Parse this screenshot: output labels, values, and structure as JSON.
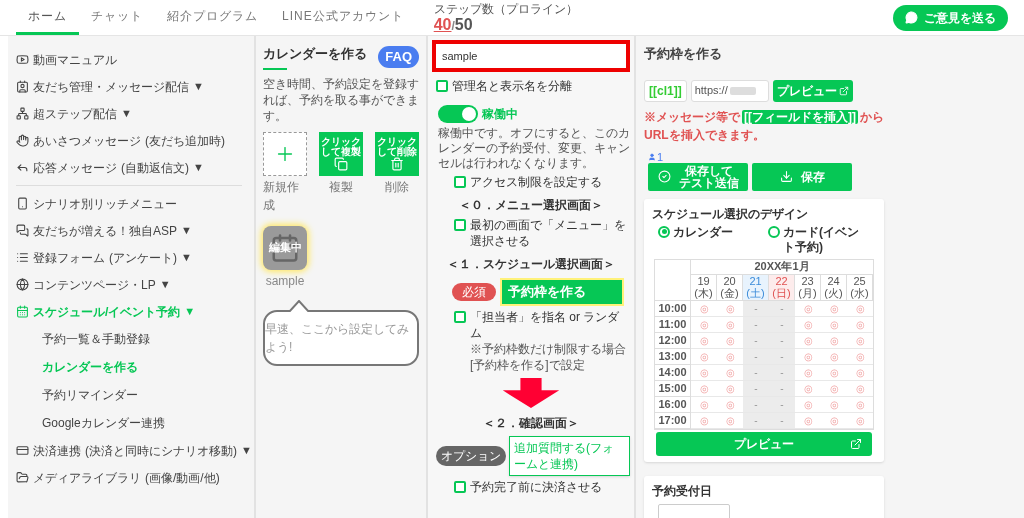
{
  "tabs": [
    {
      "label": "ホーム",
      "selected": true
    },
    {
      "label": "チャット",
      "selected": false
    },
    {
      "label": "紹介プログラム",
      "selected": false
    },
    {
      "label": "LINE公式アカウント",
      "selected": false
    }
  ],
  "step_counter": {
    "label": "ステップ数（プロライン）",
    "current": "40",
    "separator": "/",
    "total": "50"
  },
  "feedback_button": {
    "label": "ご意見を送る"
  },
  "sidebar": {
    "items": [
      {
        "kind": "item",
        "label": "動画マニュアル",
        "selected": false
      },
      {
        "kind": "item",
        "label": "友だち管理・メッセージ配信",
        "arrow": "▼",
        "selected": false
      },
      {
        "kind": "item",
        "label": "超ステップ配信",
        "arrow": "▼",
        "selected": false
      },
      {
        "kind": "item",
        "label": "あいさつメッセージ",
        "note": "(友だち追加時)",
        "selected": false
      },
      {
        "kind": "item",
        "label": "応答メッセージ",
        "note": "(自動返信文)",
        "arrow": "▼",
        "selected": false
      },
      {
        "kind": "divider"
      },
      {
        "kind": "item",
        "label": "シナリオ別リッチメニュー",
        "selected": false
      },
      {
        "kind": "item",
        "label": "友だちが増える！独自ASP",
        "arrow": "▼",
        "selected": false
      },
      {
        "kind": "item",
        "label": "登録フォーム",
        "note": "(アンケート)",
        "arrow": "▼",
        "selected": false
      },
      {
        "kind": "item",
        "label": "コンテンツページ・LP",
        "arrow": "▼",
        "selected": false
      },
      {
        "kind": "item",
        "label": "スケジュール/イベント予約",
        "arrow": "▼",
        "selected": true
      },
      {
        "kind": "sub",
        "label": "予約一覧＆手動登録",
        "selected": false
      },
      {
        "kind": "sub",
        "label": "カレンダーを作る",
        "selected": true
      },
      {
        "kind": "sub",
        "label": "予約リマインダー",
        "selected": false
      },
      {
        "kind": "sub",
        "label": "Googleカレンダー連携",
        "selected": false
      },
      {
        "kind": "item",
        "label": "決済連携",
        "note": "(決済と同時にシナリオ移動)",
        "arrow": "▼",
        "selected": false
      },
      {
        "kind": "item",
        "label": "メディアライブラリ",
        "note": "(画像/動画/他)",
        "selected": false
      }
    ]
  },
  "calendar_panel": {
    "title": "カレンダーを作る",
    "faq": "FAQ",
    "description": "空き時間、予約設定を登録すれば、予約を取る事ができます。",
    "tiles": [
      {
        "kind": "new",
        "label": "新規作成"
      },
      {
        "kind": "copy",
        "caption_lines": [
          "クリック",
          "して複製"
        ],
        "label": "複製"
      },
      {
        "kind": "delete",
        "caption_lines": [
          "クリック",
          "して削除"
        ],
        "label": "削除"
      }
    ],
    "calendars": [
      {
        "badge": "編集中",
        "name": "sample",
        "selected": true
      }
    ],
    "hint": "早速、ここから設定してみよう!"
  },
  "settings": {
    "name_field": {
      "value": "sample"
    },
    "separate_names": {
      "label": "管理名と表示名を分離",
      "checked": false
    },
    "toggle": {
      "on": true,
      "label": "稼働中"
    },
    "toggle_note": "稼働中です。オフにすると、このカレンダーの予約受付、変更、キャンセルは行われなくなります。",
    "flow": [
      {
        "kind": "checkbox",
        "label": "アクセス制限を設定する",
        "checked": false
      },
      {
        "kind": "heading",
        "label": "＜０．メニュー選択画面＞"
      },
      {
        "kind": "checkbox",
        "label": "最初の画面で「メニュー」を選択させる",
        "checked": false
      },
      {
        "kind": "heading",
        "label": "＜１．スケジュール選択画面＞"
      },
      {
        "kind": "action",
        "badge": "必須",
        "label": "予約枠を作る"
      },
      {
        "kind": "checkbox",
        "label": "「担当者」を指名 or ランダム",
        "note": "※予約枠数だけ制限する場合[予約枠を作る]で設定",
        "checked": false
      },
      {
        "kind": "arrow"
      },
      {
        "kind": "heading",
        "label": "＜２．確認画面＞"
      },
      {
        "kind": "option",
        "badge": "オプション",
        "label": "追加質問する(フォームと連携)"
      },
      {
        "kind": "checkbox",
        "label": "予約完了前に決済させる",
        "checked": false
      }
    ]
  },
  "slots": {
    "title": "予約枠を作る",
    "tag": "[[cl1]]",
    "url_field": {
      "value": "https://"
    },
    "preview": "プレビュー",
    "notice_before": "※メッセージ等で",
    "notice_chip": "[[フィールドを挿入]]",
    "notice_after": "からURLを挿入できます。",
    "member_count": "1",
    "buttons": [
      {
        "kind": "test",
        "label_lines": [
          "保存して",
          "テスト送信"
        ]
      },
      {
        "kind": "save",
        "label_lines": [
          "保存"
        ]
      }
    ],
    "design": {
      "title": "スケジュール選択のデザイン",
      "options": [
        {
          "label": "カレンダー",
          "selected": true
        },
        {
          "label": "カード(イベント予約)",
          "selected": false
        }
      ],
      "preview_table": {
        "month": "20XX年1月",
        "days": [
          {
            "date": "19",
            "weekday": "(木)",
            "kind": "weekday"
          },
          {
            "date": "20",
            "weekday": "(金)",
            "kind": "weekday"
          },
          {
            "date": "21",
            "weekday": "(土)",
            "kind": "saturday"
          },
          {
            "date": "22",
            "weekday": "(日)",
            "kind": "sunday"
          },
          {
            "date": "23",
            "weekday": "(月)",
            "kind": "weekday"
          },
          {
            "date": "24",
            "weekday": "(火)",
            "kind": "weekday"
          },
          {
            "date": "25",
            "weekday": "(水)",
            "kind": "weekday"
          }
        ],
        "rows": [
          {
            "time": "10:00",
            "cells": [
              "◎",
              "◎",
              "-",
              "-",
              "◎",
              "◎",
              "◎"
            ]
          },
          {
            "time": "11:00",
            "cells": [
              "◎",
              "◎",
              "-",
              "-",
              "◎",
              "◎",
              "◎"
            ]
          },
          {
            "time": "12:00",
            "cells": [
              "◎",
              "◎",
              "-",
              "-",
              "◎",
              "◎",
              "◎"
            ]
          },
          {
            "time": "13:00",
            "cells": [
              "◎",
              "◎",
              "-",
              "-",
              "◎",
              "◎",
              "◎"
            ]
          },
          {
            "time": "14:00",
            "cells": [
              "◎",
              "◎",
              "-",
              "-",
              "◎",
              "◎",
              "◎"
            ]
          },
          {
            "time": "15:00",
            "cells": [
              "◎",
              "◎",
              "-",
              "-",
              "◎",
              "◎",
              "◎"
            ]
          },
          {
            "time": "16:00",
            "cells": [
              "◎",
              "◎",
              "-",
              "-",
              "◎",
              "◎",
              "◎"
            ]
          },
          {
            "time": "17:00",
            "cells": [
              "◎",
              "◎",
              "-",
              "-",
              "◎",
              "◎",
              "◎"
            ]
          }
        ]
      },
      "preview": "プレビュー"
    },
    "reception": {
      "title": "予約受付日"
    }
  }
}
